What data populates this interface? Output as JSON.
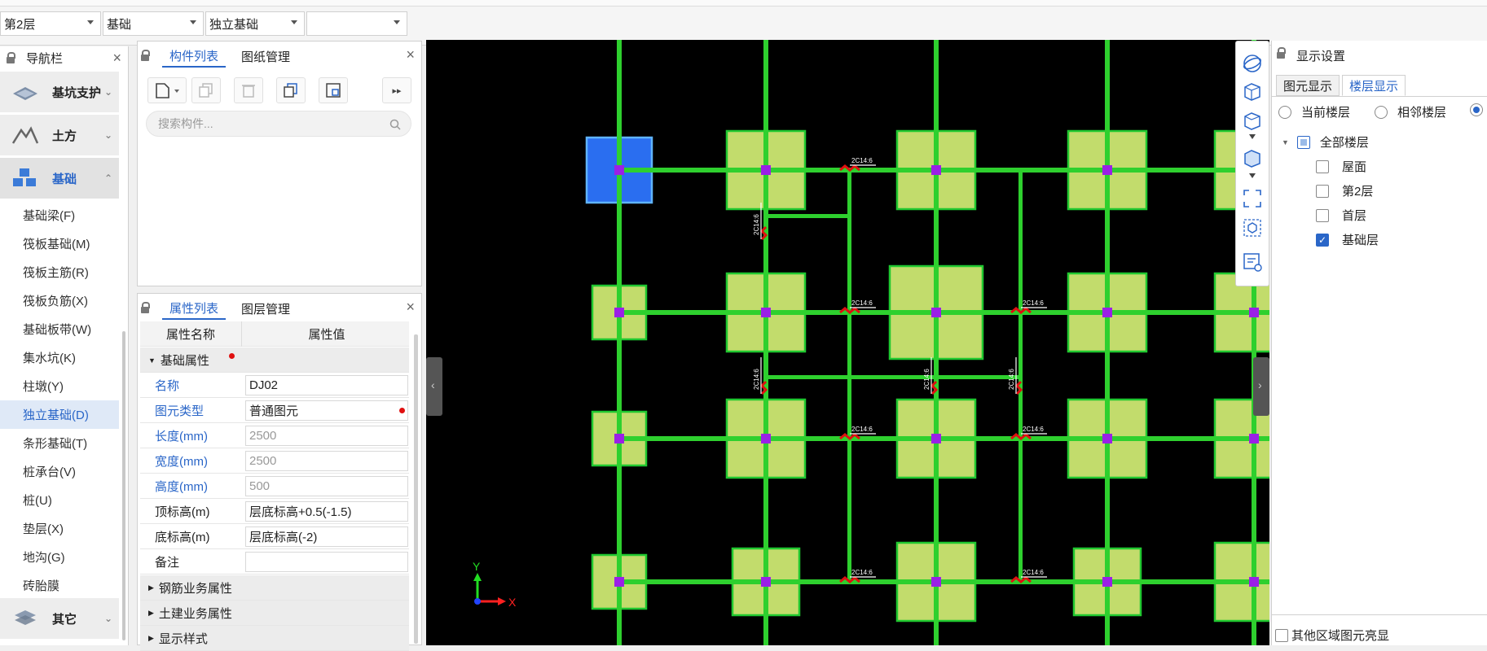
{
  "selectors": {
    "floor": "第2层",
    "category": "基础",
    "type": "独立基础",
    "instance": ""
  },
  "nav": {
    "title": "导航栏",
    "categories": [
      {
        "label": "基坑支护",
        "icon": "excavation-support-icon"
      },
      {
        "label": "土方",
        "icon": "earthwork-icon"
      },
      {
        "label": "基础",
        "icon": "foundation-icon"
      },
      {
        "label": "其它",
        "icon": "other-layers-icon"
      }
    ],
    "items": [
      "基础梁(F)",
      "筏板基础(M)",
      "筏板主筋(R)",
      "筏板负筋(X)",
      "基础板带(W)",
      "集水坑(K)",
      "柱墩(Y)",
      "独立基础(D)",
      "条形基础(T)",
      "桩承台(V)",
      "桩(U)",
      "垫层(X)",
      "地沟(G)",
      "砖胎膜"
    ],
    "selected_item": "独立基础(D)"
  },
  "component_panel": {
    "tab_active": "构件列表",
    "tab_other": "图纸管理",
    "search_placeholder": "搜索构件..."
  },
  "property_panel": {
    "tab_active": "属性列表",
    "tab_other": "图层管理",
    "col_name": "属性名称",
    "col_value": "属性值",
    "group_basic": "基础属性",
    "rows": [
      {
        "name": "名称",
        "value": "DJ02"
      },
      {
        "name": "图元类型",
        "value": "普通图元"
      },
      {
        "name": "长度(mm)",
        "value": "2500"
      },
      {
        "name": "宽度(mm)",
        "value": "2500"
      },
      {
        "name": "高度(mm)",
        "value": "500"
      },
      {
        "name": "顶标高(m)",
        "value": "层底标高+0.5(-1.5)"
      },
      {
        "name": "底标高(m)",
        "value": "层底标高(-2)"
      },
      {
        "name": "备注",
        "value": ""
      }
    ],
    "groups": [
      "钢筋业务属性",
      "土建业务属性",
      "显示样式"
    ]
  },
  "canvas": {
    "axis_x": "X",
    "axis_y": "Y",
    "rebar_label": "2C14:6"
  },
  "display_panel": {
    "title": "显示设置",
    "tab_element": "图元显示",
    "tab_floor": "楼层显示",
    "radio_current": "当前楼层",
    "radio_adjacent": "相邻楼层",
    "tree_all": "全部楼层",
    "floors": [
      {
        "label": "屋面",
        "checked": false
      },
      {
        "label": "第2层",
        "checked": false
      },
      {
        "label": "首层",
        "checked": false
      },
      {
        "label": "基础层",
        "checked": true
      }
    ],
    "footer_check": "其他区域图元亮显"
  },
  "colors": {
    "accent": "#2a66c8",
    "footing_fill": "#c2dc6c",
    "footing_border": "#20c830",
    "beam": "#2ed02e",
    "column": "#9b20e6",
    "selected_footing": "#2a6ef0",
    "rebar_mark": "#e01010"
  }
}
